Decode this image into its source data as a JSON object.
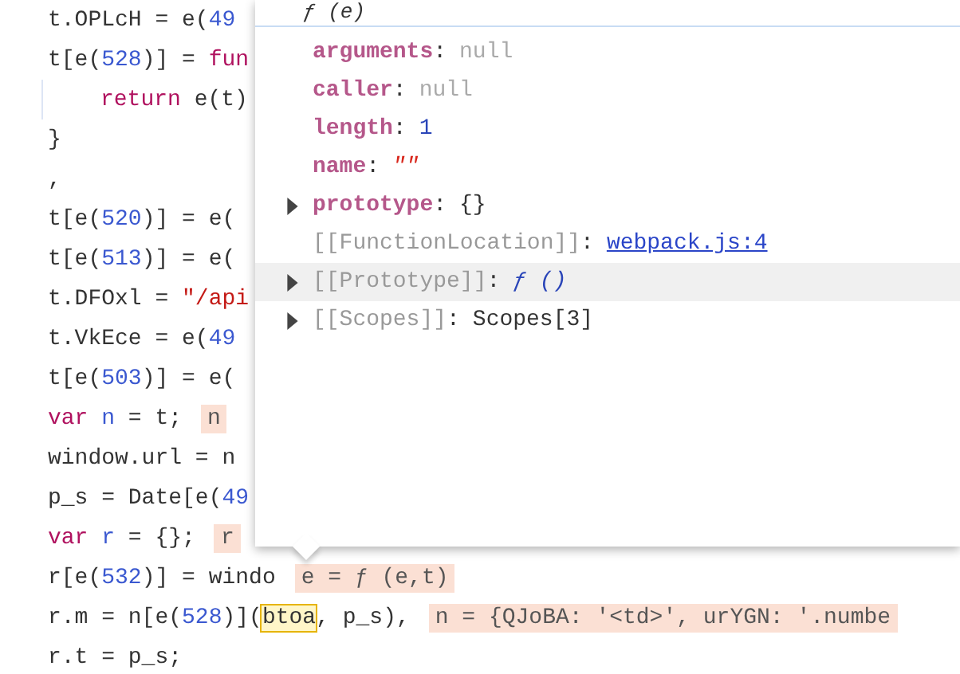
{
  "code_lines": [
    {
      "tokens": [
        {
          "kind": "plain",
          "text": "t.OPLcH = e("
        },
        {
          "kind": "num",
          "text": "49"
        }
      ]
    },
    {
      "tokens": [
        {
          "kind": "plain",
          "text": "t[e("
        },
        {
          "kind": "num",
          "text": "528"
        },
        {
          "kind": "plain",
          "text": ")] = "
        },
        {
          "kind": "kw",
          "text": "fun"
        }
      ]
    },
    {
      "indent": true,
      "tokens": [
        {
          "kind": "kw",
          "text": "return"
        },
        {
          "kind": "plain",
          "text": " e(t)"
        }
      ]
    },
    {
      "tokens": [
        {
          "kind": "plain",
          "text": "}"
        }
      ]
    },
    {
      "tokens": [
        {
          "kind": "plain",
          "text": ","
        }
      ]
    },
    {
      "tokens": [
        {
          "kind": "plain",
          "text": "t[e("
        },
        {
          "kind": "num",
          "text": "520"
        },
        {
          "kind": "plain",
          "text": ")] = e("
        }
      ]
    },
    {
      "tokens": [
        {
          "kind": "plain",
          "text": "t[e("
        },
        {
          "kind": "num",
          "text": "513"
        },
        {
          "kind": "plain",
          "text": ")] = e("
        }
      ]
    },
    {
      "tokens": [
        {
          "kind": "plain",
          "text": "t.DFOxl = "
        },
        {
          "kind": "str",
          "text": "\"/api"
        }
      ]
    },
    {
      "tokens": [
        {
          "kind": "plain",
          "text": "t.VkEce = e("
        },
        {
          "kind": "num",
          "text": "49"
        }
      ]
    },
    {
      "tokens": [
        {
          "kind": "plain",
          "text": "t[e("
        },
        {
          "kind": "num",
          "text": "503"
        },
        {
          "kind": "plain",
          "text": ")] = e("
        }
      ]
    },
    {
      "tokens": [
        {
          "kind": "kw",
          "text": "var"
        },
        {
          "kind": "var",
          "text": " n"
        },
        {
          "kind": "plain",
          "text": " = t;"
        }
      ],
      "inline_value": "n"
    },
    {
      "tokens": [
        {
          "kind": "plain",
          "text": "window.url = n"
        }
      ]
    },
    {
      "tokens": [
        {
          "kind": "plain",
          "text": "p_s = Date[e("
        },
        {
          "kind": "num",
          "text": "49"
        }
      ]
    },
    {
      "tokens": [
        {
          "kind": "kw",
          "text": "var"
        },
        {
          "kind": "var",
          "text": " r"
        },
        {
          "kind": "plain",
          "text": " = {};"
        }
      ],
      "inline_value": "r"
    },
    {
      "tokens": [
        {
          "kind": "plain",
          "text": "r[e("
        },
        {
          "kind": "num",
          "text": "532"
        },
        {
          "kind": "plain",
          "text": ")] = windo"
        }
      ],
      "inline_value": "e = ƒ (e,t)"
    },
    {
      "tokens": [
        {
          "kind": "plain",
          "text": "r.m = n[e("
        },
        {
          "kind": "num",
          "text": "528"
        },
        {
          "kind": "plain",
          "text": ")]("
        },
        {
          "kind": "hover",
          "text": "btoa"
        },
        {
          "kind": "plain",
          "text": ", p_s),"
        }
      ],
      "inline_value": "n = {QJoBA: '<td>', urYGN: '.numbe"
    },
    {
      "tokens": [
        {
          "kind": "plain",
          "text": "r.t = p_s;"
        }
      ]
    }
  ],
  "popover": {
    "title": "ƒ (e)",
    "properties": [
      {
        "kind": "own",
        "expandable": false,
        "highlighted": false,
        "name": "arguments",
        "colon": ":",
        "value": {
          "kind": "null",
          "text": "null"
        }
      },
      {
        "kind": "own",
        "expandable": false,
        "highlighted": false,
        "name": "caller",
        "colon": ":",
        "value": {
          "kind": "null",
          "text": "null"
        }
      },
      {
        "kind": "own",
        "expandable": false,
        "highlighted": false,
        "name": "length",
        "colon": ":",
        "value": {
          "kind": "number",
          "text": "1"
        }
      },
      {
        "kind": "own",
        "expandable": false,
        "highlighted": false,
        "name": "name",
        "colon": ":",
        "value": {
          "kind": "string",
          "text": "\"\""
        }
      },
      {
        "kind": "own",
        "expandable": true,
        "highlighted": false,
        "name": "prototype",
        "colon": ":",
        "value": {
          "kind": "object",
          "text": "{}"
        }
      },
      {
        "kind": "internal",
        "expandable": false,
        "highlighted": false,
        "name": "[[FunctionLocation]]",
        "colon": ":",
        "value": {
          "kind": "link",
          "text": "webpack.js:4"
        }
      },
      {
        "kind": "internal",
        "expandable": true,
        "highlighted": true,
        "name": "[[Prototype]]",
        "colon": ":",
        "value": {
          "kind": "function",
          "text": "ƒ ()"
        }
      },
      {
        "kind": "internal",
        "expandable": true,
        "highlighted": false,
        "name": "[[Scopes]]",
        "colon": ":",
        "value": {
          "kind": "object",
          "text": "Scopes[3]"
        }
      }
    ]
  }
}
